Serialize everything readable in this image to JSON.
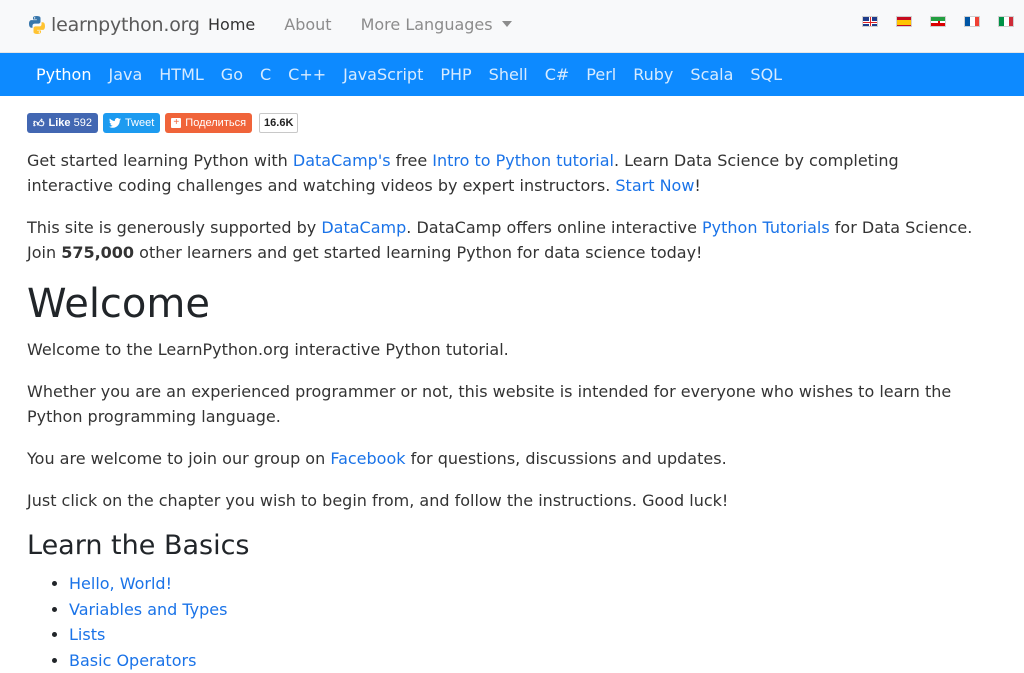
{
  "header": {
    "logo_text": "learnpython.org",
    "nav": [
      {
        "label": "Home"
      },
      {
        "label": "About"
      },
      {
        "label": "More Languages"
      }
    ],
    "flags": [
      "English",
      "Español",
      "فارسی",
      "Français",
      "Italiano"
    ]
  },
  "langbar": {
    "items": [
      "Python",
      "Java",
      "HTML",
      "Go",
      "C",
      "C++",
      "JavaScript",
      "PHP",
      "Shell",
      "C#",
      "Perl",
      "Ruby",
      "Scala",
      "SQL"
    ]
  },
  "social": {
    "like_label": "Like",
    "like_count": "592",
    "tweet_label": "Tweet",
    "share_label": "Поделиться",
    "share_count": "16.6K"
  },
  "intro": {
    "p1_a": "Get started learning Python with ",
    "p1_link1": "DataCamp's",
    "p1_b": " free ",
    "p1_link2": "Intro to Python tutorial",
    "p1_c": ". Learn Data Science by completing interactive coding challenges and watching videos by expert instructors. ",
    "p1_link3": "Start Now",
    "p1_d": "!",
    "p2_a": "This site is generously supported by ",
    "p2_link1": "DataCamp",
    "p2_b": ". DataCamp offers online interactive ",
    "p2_link2": "Python Tutorials",
    "p2_c": " for Data Science. Join ",
    "p2_bold": "575,000",
    "p2_d": " other learners and get started learning Python for data science today!"
  },
  "welcome": {
    "title": "Welcome",
    "p1": "Welcome to the LearnPython.org interactive Python tutorial.",
    "p2": "Whether you are an experienced programmer or not, this website is intended for everyone who wishes to learn the Python programming language.",
    "p3_a": "You are welcome to join our group on ",
    "p3_link": "Facebook",
    "p3_b": " for questions, discussions and updates.",
    "p4": "Just click on the chapter you wish to begin from, and follow the instructions. Good luck!"
  },
  "basics": {
    "title": "Learn the Basics",
    "items": [
      "Hello, World!",
      "Variables and Types",
      "Lists",
      "Basic Operators"
    ]
  }
}
